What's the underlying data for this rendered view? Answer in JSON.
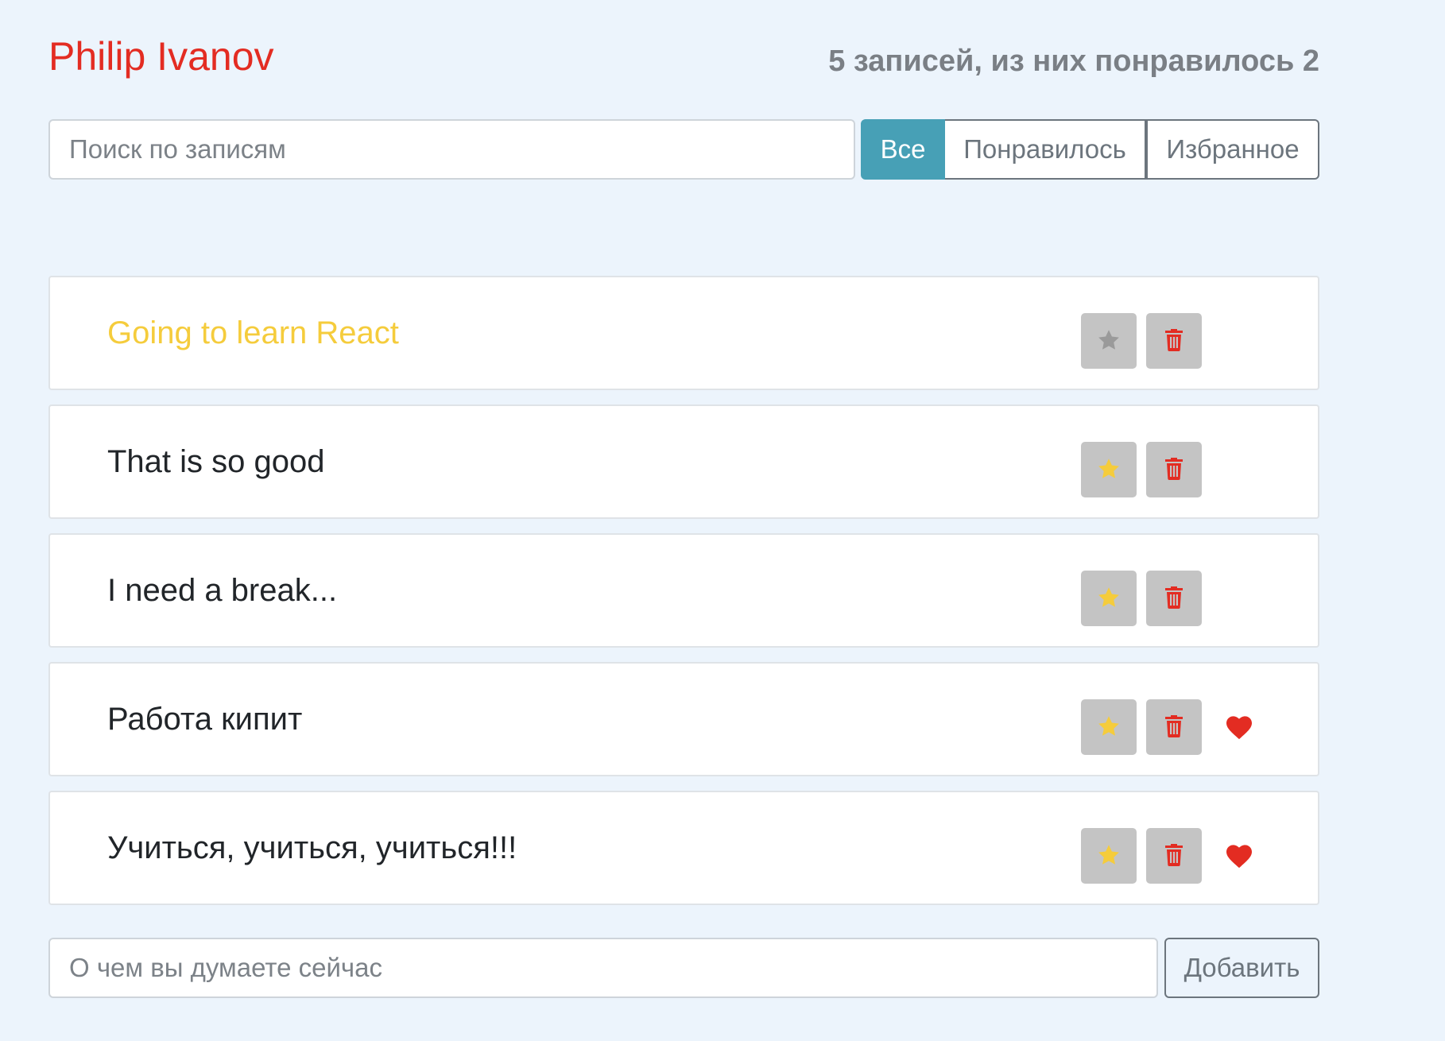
{
  "header": {
    "title": "Philip Ivanov",
    "stats": "5 записей, из них понравилось 2"
  },
  "search": {
    "placeholder": "Поиск по записям",
    "value": ""
  },
  "filters": {
    "all": "Все",
    "liked": "Понравилось",
    "favorites": "Избранное",
    "active": "all"
  },
  "posts": [
    {
      "label": "Going to learn React",
      "important": true,
      "liked": false
    },
    {
      "label": "That is so good",
      "important": false,
      "liked": false
    },
    {
      "label": "I need a break...",
      "important": false,
      "liked": false
    },
    {
      "label": "Работа кипит",
      "important": false,
      "liked": true
    },
    {
      "label": "Учиться, учиться, учиться!!!",
      "important": false,
      "liked": true
    }
  ],
  "add_form": {
    "placeholder": "О чем вы думаете сейчас",
    "value": "",
    "button_label": "Добавить"
  },
  "colors": {
    "title": "#e32c22",
    "star_active": "#f5cc3c",
    "star_inactive": "#9a9a9a",
    "trash": "#e32c22",
    "heart": "#e32c22",
    "filter_active": "#47a0b6"
  }
}
